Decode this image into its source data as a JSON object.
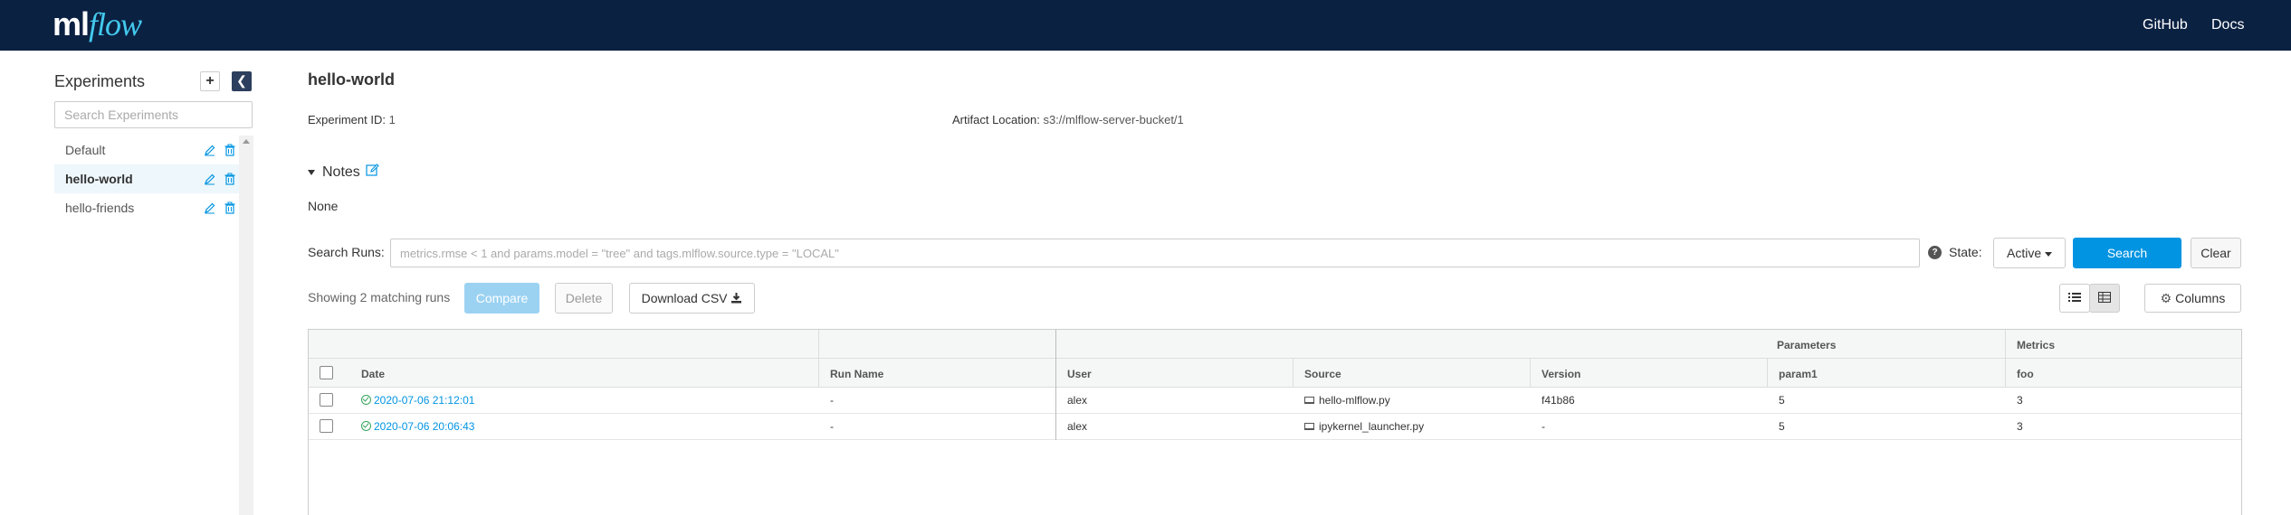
{
  "header": {
    "logo_ml": "ml",
    "logo_flow": "flow",
    "links": [
      "GitHub",
      "Docs"
    ]
  },
  "sidebar": {
    "title": "Experiments",
    "add_icon": "plus-icon",
    "collapse_icon": "chevron-left-icon",
    "search_placeholder": "Search Experiments",
    "items": [
      {
        "label": "Default",
        "active": false
      },
      {
        "label": "hello-world",
        "active": true
      },
      {
        "label": "hello-friends",
        "active": false
      }
    ]
  },
  "experiment": {
    "name": "hello-world",
    "id_label": "Experiment ID:",
    "id_value": "1",
    "artifact_label": "Artifact Location:",
    "artifact_value": "s3://mlflow-server-bucket/1",
    "notes_label": "Notes",
    "notes_value": "None"
  },
  "search": {
    "label": "Search Runs:",
    "placeholder": "metrics.rmse < 1 and params.model = \"tree\" and tags.mlflow.source.type = \"LOCAL\"",
    "state_label": "State:",
    "state_value": "Active",
    "search_button": "Search",
    "clear_button": "Clear"
  },
  "toolbar": {
    "showing_text": "Showing 2 matching runs",
    "compare_button": "Compare",
    "delete_button": "Delete",
    "csv_button": "Download CSV",
    "columns_button": "Columns"
  },
  "table": {
    "group_headers": {
      "parameters": "Parameters",
      "metrics": "Metrics"
    },
    "columns": [
      "Date",
      "Run Name",
      "User",
      "Source",
      "Version",
      "param1",
      "foo"
    ],
    "rows": [
      {
        "date": "2020-07-06 21:12:01",
        "run_name": "-",
        "user": "alex",
        "source": "hello-mlflow.py",
        "version": "f41b86",
        "param1": "5",
        "foo": "3"
      },
      {
        "date": "2020-07-06 20:06:43",
        "run_name": "-",
        "user": "alex",
        "source": "ipykernel_launcher.py",
        "version": "-",
        "param1": "5",
        "foo": "3"
      }
    ]
  },
  "colors": {
    "topbar": "#0b2142",
    "accent": "#0194e2",
    "logo_flow": "#43c9ed",
    "success": "#37a55c"
  }
}
